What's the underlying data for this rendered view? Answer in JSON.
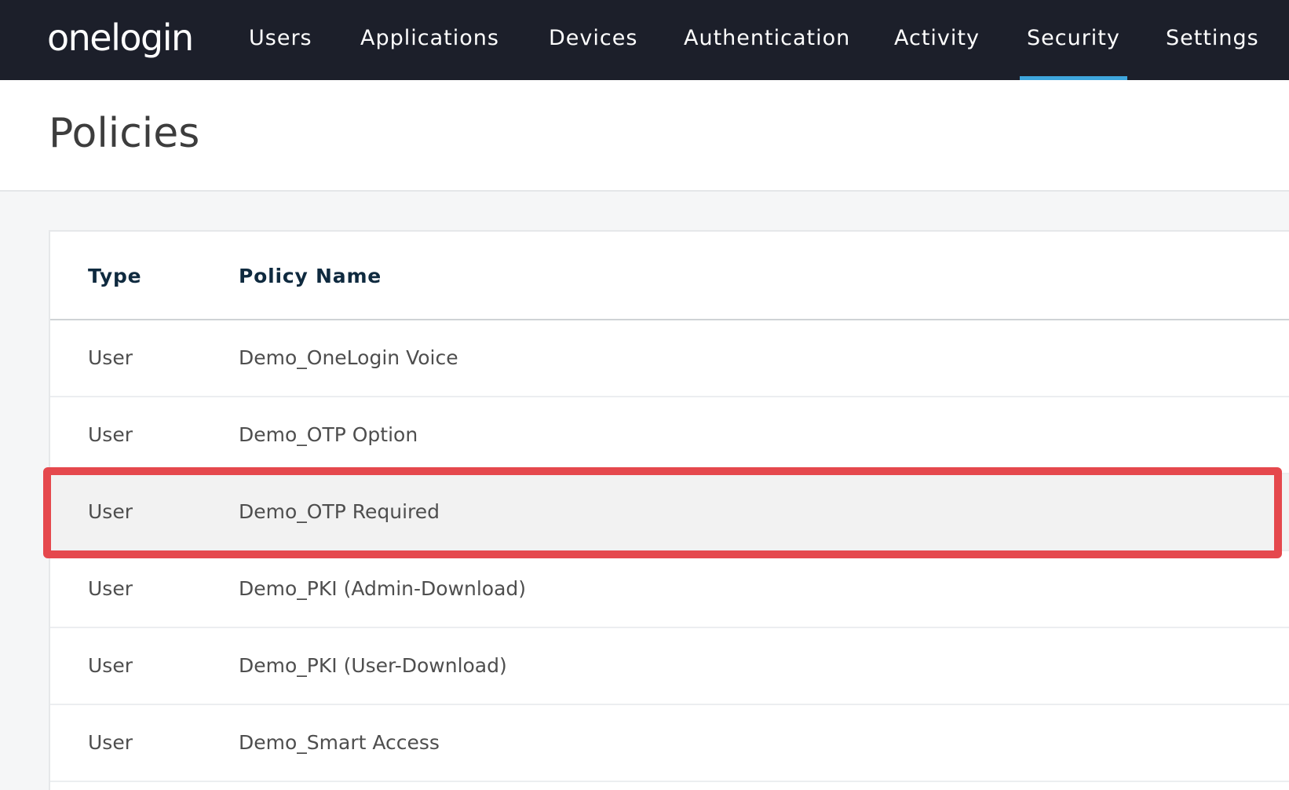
{
  "nav": {
    "logo": "onelogin",
    "items": [
      {
        "label": "Users",
        "active": false
      },
      {
        "label": "Applications",
        "active": false
      },
      {
        "label": "Devices",
        "active": false
      },
      {
        "label": "Authentication",
        "active": false
      },
      {
        "label": "Activity",
        "active": false
      },
      {
        "label": "Security",
        "active": true
      },
      {
        "label": "Settings",
        "active": false
      }
    ]
  },
  "page": {
    "title": "Policies"
  },
  "table": {
    "columns": [
      "Type",
      "Policy Name"
    ],
    "rows": [
      {
        "type": "User",
        "name": "Demo_OneLogin Voice"
      },
      {
        "type": "User",
        "name": "Demo_OTP Option"
      },
      {
        "type": "User",
        "name": "Demo_OTP Required",
        "highlighted": true
      },
      {
        "type": "User",
        "name": "Demo_PKI (Admin-Download)"
      },
      {
        "type": "User",
        "name": "Demo_PKI (User-Download)"
      },
      {
        "type": "User",
        "name": "Demo_Smart Access"
      }
    ]
  },
  "colors": {
    "nav_background": "#1c1f2a",
    "active_tab_indicator": "#3ea6dd",
    "highlight_border": "#e5484d"
  }
}
